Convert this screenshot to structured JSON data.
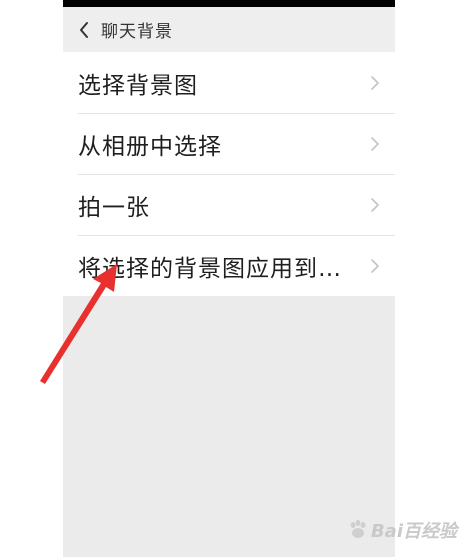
{
  "header": {
    "title": "聊天背景",
    "back_icon": "chevron-left-icon"
  },
  "menu": {
    "items": [
      {
        "label": "选择背景图"
      },
      {
        "label": "从相册中选择"
      },
      {
        "label": "拍一张"
      },
      {
        "label": "将选择的背景图应用到…"
      }
    ],
    "chevron_icon": "chevron-right-icon"
  },
  "annotation": {
    "arrow_color": "#e8312f"
  },
  "watermark": {
    "text": "Bai百经验",
    "logo": "baidu-paw-logo"
  }
}
